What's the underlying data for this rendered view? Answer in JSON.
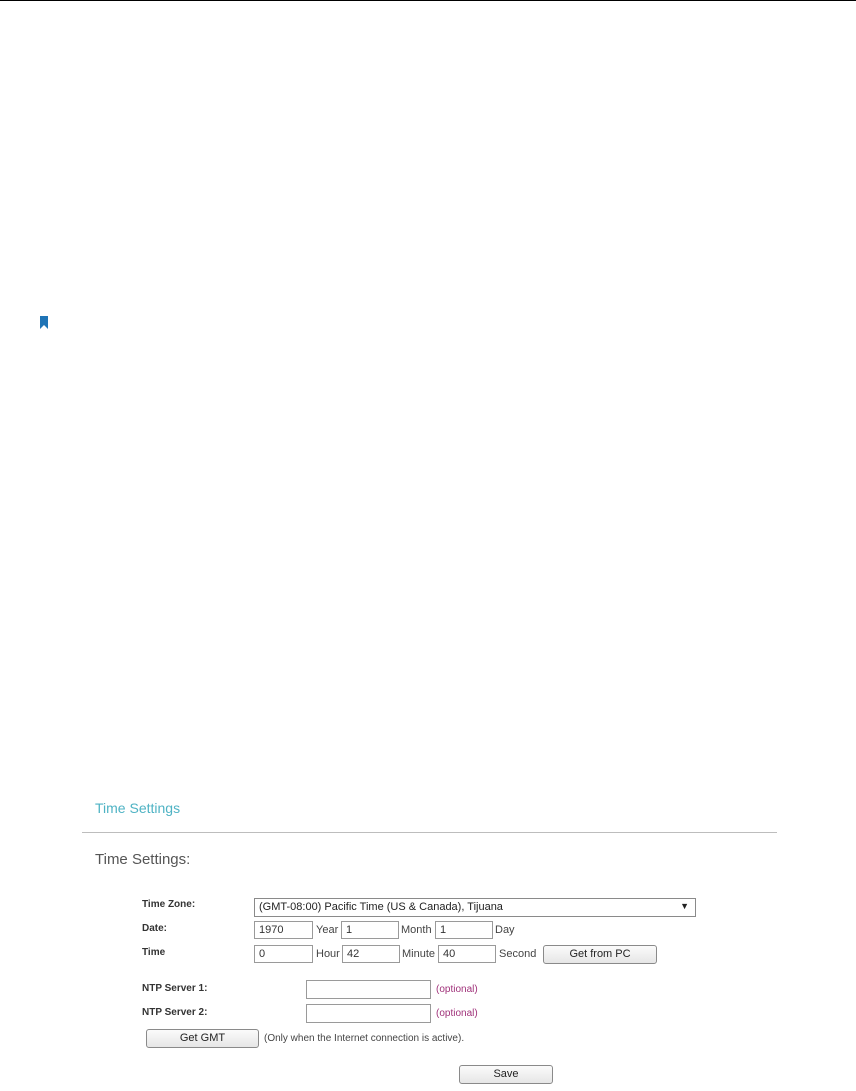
{
  "colors": {
    "accent": "#4fb3c4",
    "optional": "#a0327a",
    "bookmark": "#1f74b6"
  },
  "icons": {
    "bookmark": "bookmark-icon",
    "dropdown": "chevron-down-icon"
  },
  "card": {
    "title": "Time Settings"
  },
  "section": {
    "title": "Time Settings:"
  },
  "timezone": {
    "label": "Time Zone:",
    "value": "(GMT-08:00) Pacific Time (US & Canada), Tijuana",
    "arrow": "▼"
  },
  "date": {
    "label": "Date:",
    "year": "1970",
    "year_unit": "Year",
    "month": "1",
    "month_unit": "Month",
    "day": "1",
    "day_unit": "Day"
  },
  "time": {
    "label": "Time",
    "hour": "0",
    "hour_unit": "Hour",
    "minute": "42",
    "minute_unit": "Minute",
    "second": "40",
    "second_unit": "Second",
    "get_from_pc": "Get from PC"
  },
  "ntp": {
    "server1_label": "NTP Server 1:",
    "server1_value": "",
    "server2_label": "NTP Server 2:",
    "server2_value": "",
    "optional": "(optional)"
  },
  "gmt": {
    "button": "Get GMT",
    "note": "(Only when the Internet connection is active)."
  },
  "save": {
    "label": "Save"
  }
}
